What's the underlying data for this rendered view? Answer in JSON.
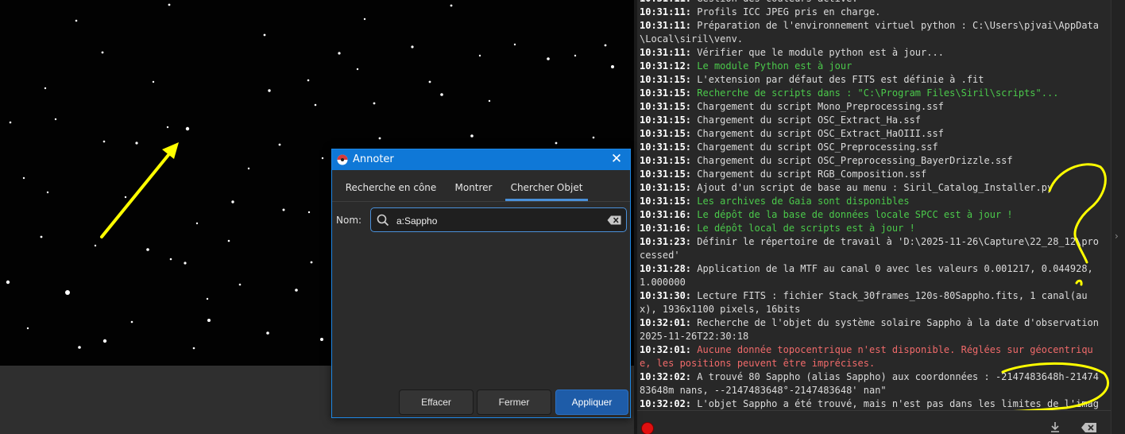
{
  "dialog": {
    "title": "Annoter",
    "close_glyph": "✕",
    "tabs": [
      {
        "label": "Recherche en cône",
        "active": false
      },
      {
        "label": "Montrer",
        "active": false
      },
      {
        "label": "Chercher Objet",
        "active": true
      }
    ],
    "name_label": "Nom:",
    "search_value": "a:Sappho",
    "buttons": {
      "clear": "Effacer",
      "close": "Fermer",
      "apply": "Appliquer"
    },
    "accent_color": "#0f78d7"
  },
  "console": {
    "lines": [
      {
        "ts": "10:31:11:",
        "msg": "Gestion des couleurs activé.",
        "color": "normal"
      },
      {
        "ts": "10:31:11:",
        "msg": "Profils ICC JPEG pris en charge.",
        "color": "normal"
      },
      {
        "ts": "10:31:11:",
        "msg": "Préparation de l'environnement virtuel python : C:\\Users\\pjvai\\AppData\\Local\\siril\\venv.",
        "color": "normal"
      },
      {
        "ts": "10:31:11:",
        "msg": "Vérifier que le module python est à jour...",
        "color": "normal"
      },
      {
        "ts": "10:31:12:",
        "msg": "Le module Python est à jour",
        "color": "green"
      },
      {
        "ts": "10:31:15:",
        "msg": "L'extension par défaut des FITS est définie à .fit",
        "color": "normal"
      },
      {
        "ts": "10:31:15:",
        "msg": "Recherche de scripts dans : \"C:\\Program Files\\Siril\\scripts\"...",
        "color": "green"
      },
      {
        "ts": "10:31:15:",
        "msg": "Chargement du script Mono_Preprocessing.ssf",
        "color": "normal"
      },
      {
        "ts": "10:31:15:",
        "msg": "Chargement du script OSC_Extract_Ha.ssf",
        "color": "normal"
      },
      {
        "ts": "10:31:15:",
        "msg": "Chargement du script OSC_Extract_HaOIII.ssf",
        "color": "normal"
      },
      {
        "ts": "10:31:15:",
        "msg": "Chargement du script OSC_Preprocessing.ssf",
        "color": "normal"
      },
      {
        "ts": "10:31:15:",
        "msg": "Chargement du script OSC_Preprocessing_BayerDrizzle.ssf",
        "color": "normal"
      },
      {
        "ts": "10:31:15:",
        "msg": "Chargement du script RGB_Composition.ssf",
        "color": "normal"
      },
      {
        "ts": "10:31:15:",
        "msg": "Ajout d'un script de base au menu : Siril_Catalog_Installer.py",
        "color": "normal"
      },
      {
        "ts": "10:31:15:",
        "msg": "Les archives de Gaia sont disponibles",
        "color": "green"
      },
      {
        "ts": "10:31:16:",
        "msg": "Le dépôt de la base de données locale SPCC est à jour !",
        "color": "green"
      },
      {
        "ts": "10:31:16:",
        "msg": "Le dépôt local de scripts est à jour !",
        "color": "green"
      },
      {
        "ts": "10:31:23:",
        "msg": "Définir le répertoire de travail à 'D:\\2025-11-26\\Capture\\22_28_12\\processed'",
        "color": "normal"
      },
      {
        "ts": "10:31:28:",
        "msg": "Application de la MTF au canal 0 avec les valeurs 0.001217, 0.044928, 1.000000",
        "color": "normal"
      },
      {
        "ts": "10:31:30:",
        "msg": "Lecture FITS : fichier Stack_30frames_120s-80Sappho.fits, 1 canal(aux), 1936x1100 pixels, 16bits",
        "color": "normal"
      },
      {
        "ts": "10:32:01:",
        "msg": "Recherche de l'objet du système solaire Sappho à la date d'observation 2025-11-26T22:30:18",
        "color": "normal"
      },
      {
        "ts": "10:32:01:",
        "msg": "Aucune donnée topocentrique n'est disponible. Réglées sur géocentrique, les positions peuvent être imprécises.",
        "color": "red"
      },
      {
        "ts": "10:32:02:",
        "msg": "A trouvé 80 Sappho (alias Sappho) aux coordonnées : -2147483648h-2147483648m nans, --2147483648°-2147483648' nan\"",
        "color": "normal"
      },
      {
        "ts": "10:32:02:",
        "msg": "L'objet Sappho a été trouvé, mais n'est pas dans les limites de l'image.",
        "color": "normal"
      }
    ],
    "colors": {
      "normal": "#dcdcdc",
      "green": "#4bc94b",
      "red": "#f06a6a",
      "annotation": "#ffff00"
    }
  },
  "icons": [
    "record-icon",
    "download-icon",
    "clear-log-icon",
    "search-icon",
    "clear-input-icon",
    "close-icon",
    "app-icon",
    "chevron-right-icon"
  ]
}
